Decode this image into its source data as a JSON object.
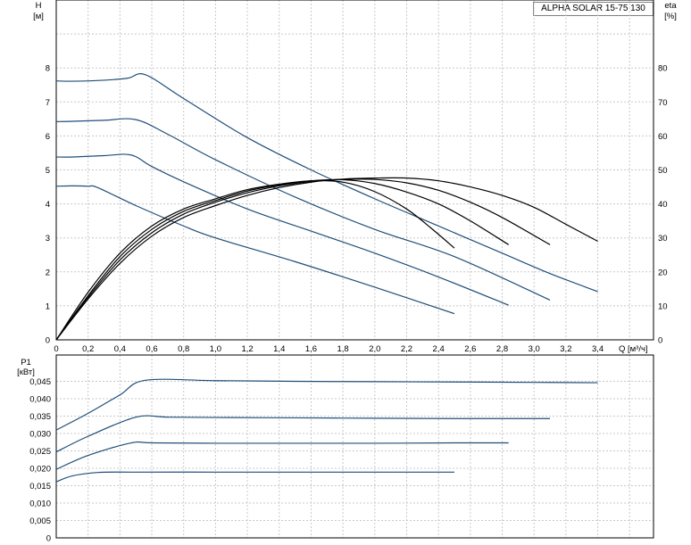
{
  "chart_data": [
    {
      "type": "line",
      "title": "ALPHA SOLAR 15-75  130",
      "ylabel": "H",
      "yunit": "[м]",
      "y2label": "eta",
      "y2unit": "[%]",
      "xlabel": "Q",
      "xunit": "[м³/ч]",
      "xlim": [
        0,
        3.75
      ],
      "ylim": [
        0,
        10
      ],
      "y2lim": [
        0,
        100
      ],
      "x_ticks": [
        "0",
        "0,2",
        "0,4",
        "0,6",
        "0,8",
        "1,0",
        "1,2",
        "1,4",
        "1,6",
        "1,8",
        "2,0",
        "2,2",
        "2,4",
        "2,6",
        "2,8",
        "3,0",
        "3,2",
        "3,4"
      ],
      "y_ticks": [
        "0",
        "1",
        "2",
        "3",
        "4",
        "5",
        "6",
        "7",
        "8"
      ],
      "y2_ticks": [
        "0",
        "10",
        "20",
        "30",
        "40",
        "50",
        "60",
        "70",
        "80"
      ],
      "grid": true,
      "head_series": [
        {
          "x": [
            0,
            0.1,
            0.2,
            0.26,
            0.5,
            0.8,
            1.0,
            1.5,
            2.0,
            2.5
          ],
          "y": [
            4.52,
            4.53,
            4.52,
            4.48,
            3.95,
            3.35,
            3.0,
            2.3,
            1.55,
            0.77
          ]
        },
        {
          "x": [
            0,
            0.1,
            0.3,
            0.47,
            0.6,
            0.8,
            1.2,
            1.6,
            2.0,
            2.4,
            2.84
          ],
          "y": [
            5.38,
            5.38,
            5.42,
            5.44,
            5.1,
            4.65,
            3.85,
            3.2,
            2.55,
            1.85,
            1.02
          ]
        },
        {
          "x": [
            0,
            0.1,
            0.3,
            0.5,
            0.7,
            1.0,
            1.5,
            2.0,
            2.5,
            3.1
          ],
          "y": [
            6.42,
            6.43,
            6.46,
            6.48,
            6.05,
            5.3,
            4.2,
            3.25,
            2.45,
            1.17
          ]
        },
        {
          "x": [
            0,
            0.1,
            0.3,
            0.45,
            0.56,
            0.8,
            1.2,
            1.6,
            2.0,
            2.4,
            2.8,
            3.1,
            3.4
          ],
          "y": [
            7.62,
            7.61,
            7.64,
            7.7,
            7.8,
            7.1,
            5.95,
            5.0,
            4.15,
            3.35,
            2.55,
            1.95,
            1.42
          ]
        }
      ],
      "eta_series": [
        {
          "x": [
            0,
            0.2,
            0.4,
            0.6,
            0.8,
            1.0,
            1.2,
            1.4,
            1.6,
            1.8,
            2.0,
            2.2,
            2.35,
            2.5
          ],
          "y": [
            0,
            14,
            25.5,
            33.5,
            38.5,
            41.5,
            44.2,
            45.8,
            46.8,
            46.4,
            43.6,
            38.5,
            33.0,
            27.0
          ]
        },
        {
          "x": [
            0,
            0.2,
            0.4,
            0.6,
            0.8,
            1.0,
            1.2,
            1.4,
            1.6,
            1.8,
            2.0,
            2.2,
            2.4,
            2.6,
            2.84
          ],
          "y": [
            0,
            13,
            24.5,
            32.5,
            37.8,
            41.0,
            43.8,
            45.6,
            46.8,
            47.1,
            46.0,
            43.5,
            40.0,
            35.0,
            28.0
          ]
        },
        {
          "x": [
            0,
            0.2,
            0.4,
            0.6,
            0.8,
            1.0,
            1.2,
            1.4,
            1.6,
            1.8,
            2.0,
            2.2,
            2.4,
            2.6,
            2.8,
            3.1
          ],
          "y": [
            0,
            12.5,
            23.5,
            31.5,
            37.0,
            40.5,
            43.3,
            45.3,
            46.6,
            47.2,
            47.2,
            46.2,
            44.0,
            40.5,
            36.0,
            28.0
          ]
        },
        {
          "x": [
            0,
            0.2,
            0.4,
            0.6,
            0.8,
            1.0,
            1.2,
            1.4,
            1.6,
            1.8,
            2.0,
            2.2,
            2.4,
            2.6,
            2.8,
            3.0,
            3.2,
            3.4
          ],
          "y": [
            0,
            12,
            22.5,
            30.5,
            36.0,
            39.5,
            42.5,
            44.8,
            46.4,
            47.3,
            47.6,
            47.6,
            46.8,
            45.0,
            42.5,
            39.0,
            34.0,
            29.0
          ]
        }
      ]
    },
    {
      "type": "line",
      "ylabel": "P1",
      "yunit": "[кВт]",
      "xlim": [
        0,
        3.75
      ],
      "ylim": [
        0,
        0.05
      ],
      "y_ticks": [
        "0",
        "0,005",
        "0,010",
        "0,015",
        "0,020",
        "0,025",
        "0,030",
        "0,035",
        "0,040",
        "0,045"
      ],
      "grid": true,
      "series": [
        {
          "x": [
            0,
            0.1,
            0.26,
            0.5,
            1.0,
            1.5,
            2.0,
            2.5
          ],
          "y": [
            0.0161,
            0.0178,
            0.0188,
            0.0189,
            0.0189,
            0.0189,
            0.0189,
            0.0189
          ]
        },
        {
          "x": [
            0,
            0.2,
            0.47,
            0.6,
            1.0,
            1.5,
            2.0,
            2.5,
            2.84
          ],
          "y": [
            0.0197,
            0.0237,
            0.0273,
            0.0273,
            0.0272,
            0.0272,
            0.0272,
            0.0273,
            0.0273
          ]
        },
        {
          "x": [
            0,
            0.2,
            0.5,
            0.7,
            1.0,
            1.5,
            2.0,
            2.5,
            3.1
          ],
          "y": [
            0.0247,
            0.0292,
            0.0347,
            0.0347,
            0.0346,
            0.0345,
            0.0344,
            0.0343,
            0.0343
          ]
        },
        {
          "x": [
            0,
            0.2,
            0.4,
            0.56,
            1.0,
            1.5,
            2.0,
            2.5,
            3.0,
            3.4
          ],
          "y": [
            0.031,
            0.0358,
            0.0411,
            0.0453,
            0.0452,
            0.045,
            0.0449,
            0.0448,
            0.0447,
            0.0446
          ]
        }
      ]
    }
  ]
}
